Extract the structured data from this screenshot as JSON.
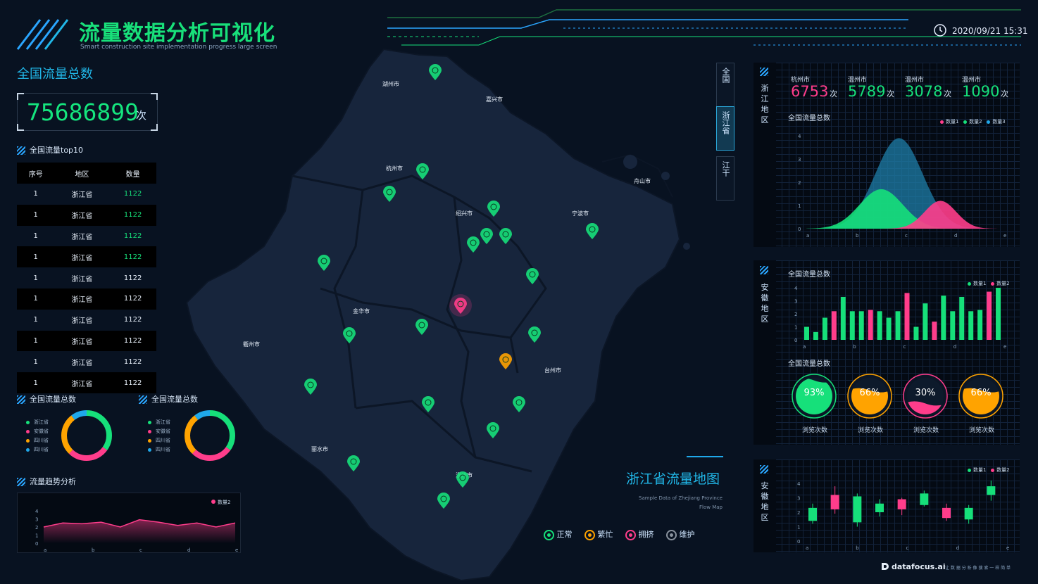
{
  "header": {
    "title": "流量数据分析可视化",
    "subtitle": "Smart construction site implementation progress large screen",
    "datetime": "2020/09/21 15:31",
    "clock_icon": "clock-icon"
  },
  "colors": {
    "green": "#16e07a",
    "pink": "#ff3d8b",
    "cyan": "#21b7e8",
    "orange": "#ffa300"
  },
  "left": {
    "total_title": "全国流量总数",
    "total_value": "75686899",
    "total_unit": "次",
    "top10_title": "全国流量top10",
    "table_headers": [
      "序号",
      "地区",
      "数量"
    ],
    "table_rows": [
      [
        "1",
        "浙江省",
        "1122"
      ],
      [
        "1",
        "浙江省",
        "1122"
      ],
      [
        "1",
        "浙江省",
        "1122"
      ],
      [
        "1",
        "浙江省",
        "1122"
      ],
      [
        "1",
        "浙江省",
        "1122"
      ],
      [
        "1",
        "浙江省",
        "1122"
      ],
      [
        "1",
        "浙江省",
        "1122"
      ],
      [
        "1",
        "浙江省",
        "1122"
      ],
      [
        "1",
        "浙江省",
        "1122"
      ],
      [
        "1",
        "浙江省",
        "1122"
      ]
    ],
    "donut1": {
      "title": "全国流量总数",
      "legend": [
        "浙江省",
        "安徽省",
        "四川省",
        "四川省"
      ]
    },
    "donut2": {
      "title": "全国流量总数",
      "legend": [
        "浙江省",
        "安徽省",
        "四川省",
        "四川省"
      ]
    },
    "trend_title": "流量趋势分析",
    "trend_legend": "数量2"
  },
  "map": {
    "tabs": [
      "全国",
      "浙江省",
      "江干"
    ],
    "active_tab": 1,
    "cities": [
      "湖州市",
      "嘉兴市",
      "杭州市",
      "舟山市",
      "绍兴市",
      "宁波市",
      "金华市",
      "衢州市",
      "台州市",
      "丽水市",
      "温州市"
    ],
    "title": "浙江省流量地图",
    "subtitle1": "Sample Data of Zhejiang Province",
    "subtitle2": "Flow Map",
    "legend": [
      "正常",
      "繁忙",
      "拥挤",
      "维护"
    ]
  },
  "right": {
    "panel1": {
      "side_label": "浙江地区",
      "stats": [
        {
          "city": "杭州市",
          "value": "6753",
          "unit": "次"
        },
        {
          "city": "温州市",
          "value": "5789",
          "unit": "次"
        },
        {
          "city": "温州市",
          "value": "3078",
          "unit": "次"
        },
        {
          "city": "温州市",
          "value": "1090",
          "unit": "次"
        }
      ],
      "chart_title": "全国流量总数",
      "legend": [
        "数量1",
        "数量2",
        "数量3"
      ]
    },
    "panel2": {
      "side_label": "安徽地区",
      "chart_title": "全国流量总数",
      "legend": [
        "数量1",
        "数量2"
      ],
      "gauge_title": "全国流量总数",
      "gauges": [
        {
          "value": "93%",
          "caption": "浏览次数"
        },
        {
          "value": "66%",
          "caption": "浏览次数"
        },
        {
          "value": "30%",
          "caption": "浏览次数"
        },
        {
          "value": "66%",
          "caption": "浏览次数"
        }
      ]
    },
    "panel3": {
      "side_label": "安徽地区",
      "legend": [
        "数量1",
        "数量2"
      ]
    }
  },
  "footer": {
    "brand": "datafocus.ai",
    "slogan": "让 数 据 分 析 像 搜 索 一 样 简 单"
  },
  "chart_data": [
    {
      "type": "area",
      "categories": [
        "a",
        "b",
        "c",
        "d",
        "e"
      ],
      "ylim": [
        0,
        4
      ],
      "yticks": [
        "0",
        "1",
        "2",
        "3",
        "4"
      ],
      "series": [
        {
          "name": "数量1",
          "values": [
            0.0,
            0.4,
            1.2,
            0.0,
            0.0
          ],
          "color": "#ff3d8b"
        },
        {
          "name": "数量2",
          "values": [
            0.0,
            1.0,
            1.7,
            0.0,
            0.0
          ],
          "color": "#16e07a"
        },
        {
          "name": "数量3",
          "values": [
            0.0,
            0.7,
            3.9,
            0.2,
            0.0
          ],
          "color": "#1d7ea8"
        }
      ]
    },
    {
      "type": "bar",
      "categories": [
        "a",
        "b",
        "c",
        "d",
        "e"
      ],
      "ylim": [
        0,
        4
      ],
      "yticks": [
        "0",
        "1",
        "2",
        "3",
        "4"
      ],
      "values": [
        1.0,
        0.6,
        1.7,
        2.2,
        3.3,
        2.2,
        2.2,
        2.3,
        2.2,
        1.7,
        2.2,
        3.6,
        1.0,
        2.8,
        1.4,
        3.4,
        2.2,
        3.3,
        2.2,
        2.3,
        3.7,
        4.0
      ],
      "value_colors": [
        "#16e07a",
        "#16e07a",
        "#16e07a",
        "#ff3d8b",
        "#16e07a",
        "#16e07a",
        "#16e07a",
        "#ff3d8b",
        "#16e07a",
        "#16e07a",
        "#16e07a",
        "#ff3d8b",
        "#16e07a",
        "#16e07a",
        "#ff3d8b",
        "#16e07a",
        "#16e07a",
        "#16e07a",
        "#16e07a",
        "#16e07a",
        "#ff3d8b",
        "#16e07a"
      ]
    },
    {
      "type": "line",
      "categories": [
        "a",
        "b",
        "c",
        "d",
        "e"
      ],
      "ylim": [
        0,
        4
      ],
      "yticks": [
        "0",
        "1",
        "2",
        "3",
        "4"
      ],
      "series": [
        {
          "name": "数量2",
          "values": [
            2.0,
            2.5,
            2.4,
            2.6,
            2.0,
            2.9,
            2.6,
            2.2,
            2.5,
            2.0,
            2.5
          ]
        }
      ]
    },
    {
      "type": "candlestick",
      "categories": [
        "a",
        "b",
        "c",
        "d",
        "e"
      ],
      "ylim": [
        0,
        4
      ],
      "yticks": [
        "0",
        "1",
        "2",
        "3",
        "4"
      ],
      "candles": [
        {
          "open": 1.4,
          "close": 2.3,
          "low": 1.2,
          "high": 2.6,
          "color": "#16e07a"
        },
        {
          "open": 3.2,
          "close": 2.2,
          "low": 1.9,
          "high": 3.8,
          "color": "#ff3d8b"
        },
        {
          "open": 1.3,
          "close": 3.1,
          "low": 1.0,
          "high": 3.3,
          "color": "#16e07a"
        },
        {
          "open": 2.0,
          "close": 2.6,
          "low": 1.7,
          "high": 2.9,
          "color": "#16e07a"
        },
        {
          "open": 2.9,
          "close": 2.2,
          "low": 1.8,
          "high": 3.0,
          "color": "#ff3d8b"
        },
        {
          "open": 2.5,
          "close": 3.3,
          "low": 2.4,
          "high": 3.5,
          "color": "#16e07a"
        },
        {
          "open": 2.3,
          "close": 1.6,
          "low": 1.4,
          "high": 2.6,
          "color": "#ff3d8b"
        },
        {
          "open": 1.5,
          "close": 2.3,
          "low": 1.2,
          "high": 2.5,
          "color": "#16e07a"
        },
        {
          "open": 3.2,
          "close": 3.8,
          "low": 2.8,
          "high": 4.2,
          "color": "#16e07a"
        }
      ]
    }
  ]
}
